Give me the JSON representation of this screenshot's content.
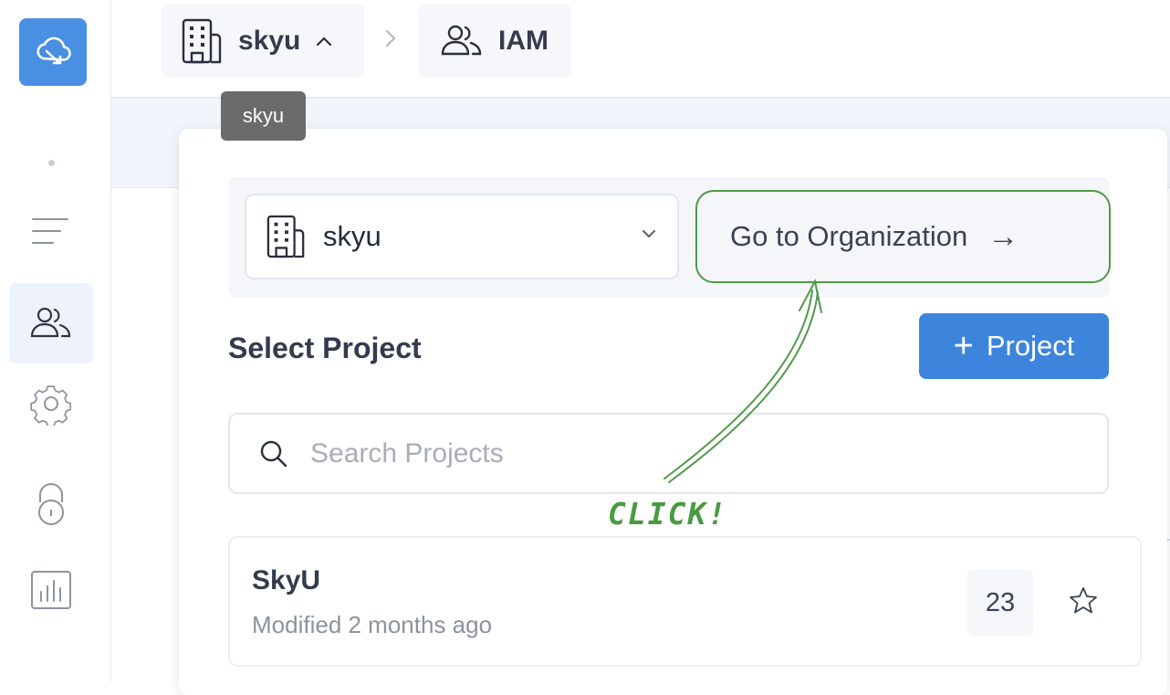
{
  "sidebar": {
    "items": [
      {
        "name": "menu-lines-icon"
      },
      {
        "name": "users-icon",
        "active": true
      },
      {
        "name": "gear-icon"
      },
      {
        "name": "lock-icon"
      },
      {
        "name": "chart-icon"
      }
    ]
  },
  "breadcrumb": {
    "org_label": "skyu",
    "section_label": "IAM"
  },
  "tooltip": {
    "text": "skyu"
  },
  "org_switcher": {
    "selected_org": "skyu",
    "goto_label": "Go to Organization",
    "goto_arrow": "→"
  },
  "projects": {
    "title": "Select Project",
    "add_button_plus": "+",
    "add_button_label": "Project",
    "search_placeholder": "Search Projects",
    "items": [
      {
        "name": "SkyU",
        "modified": "Modified 2 months ago",
        "count": "23"
      }
    ]
  },
  "annotation": {
    "text": "CLICK!"
  },
  "colors": {
    "accent": "#3d85dc",
    "highlight": "#4f9a48",
    "logo_bg": "#4a90e2"
  }
}
